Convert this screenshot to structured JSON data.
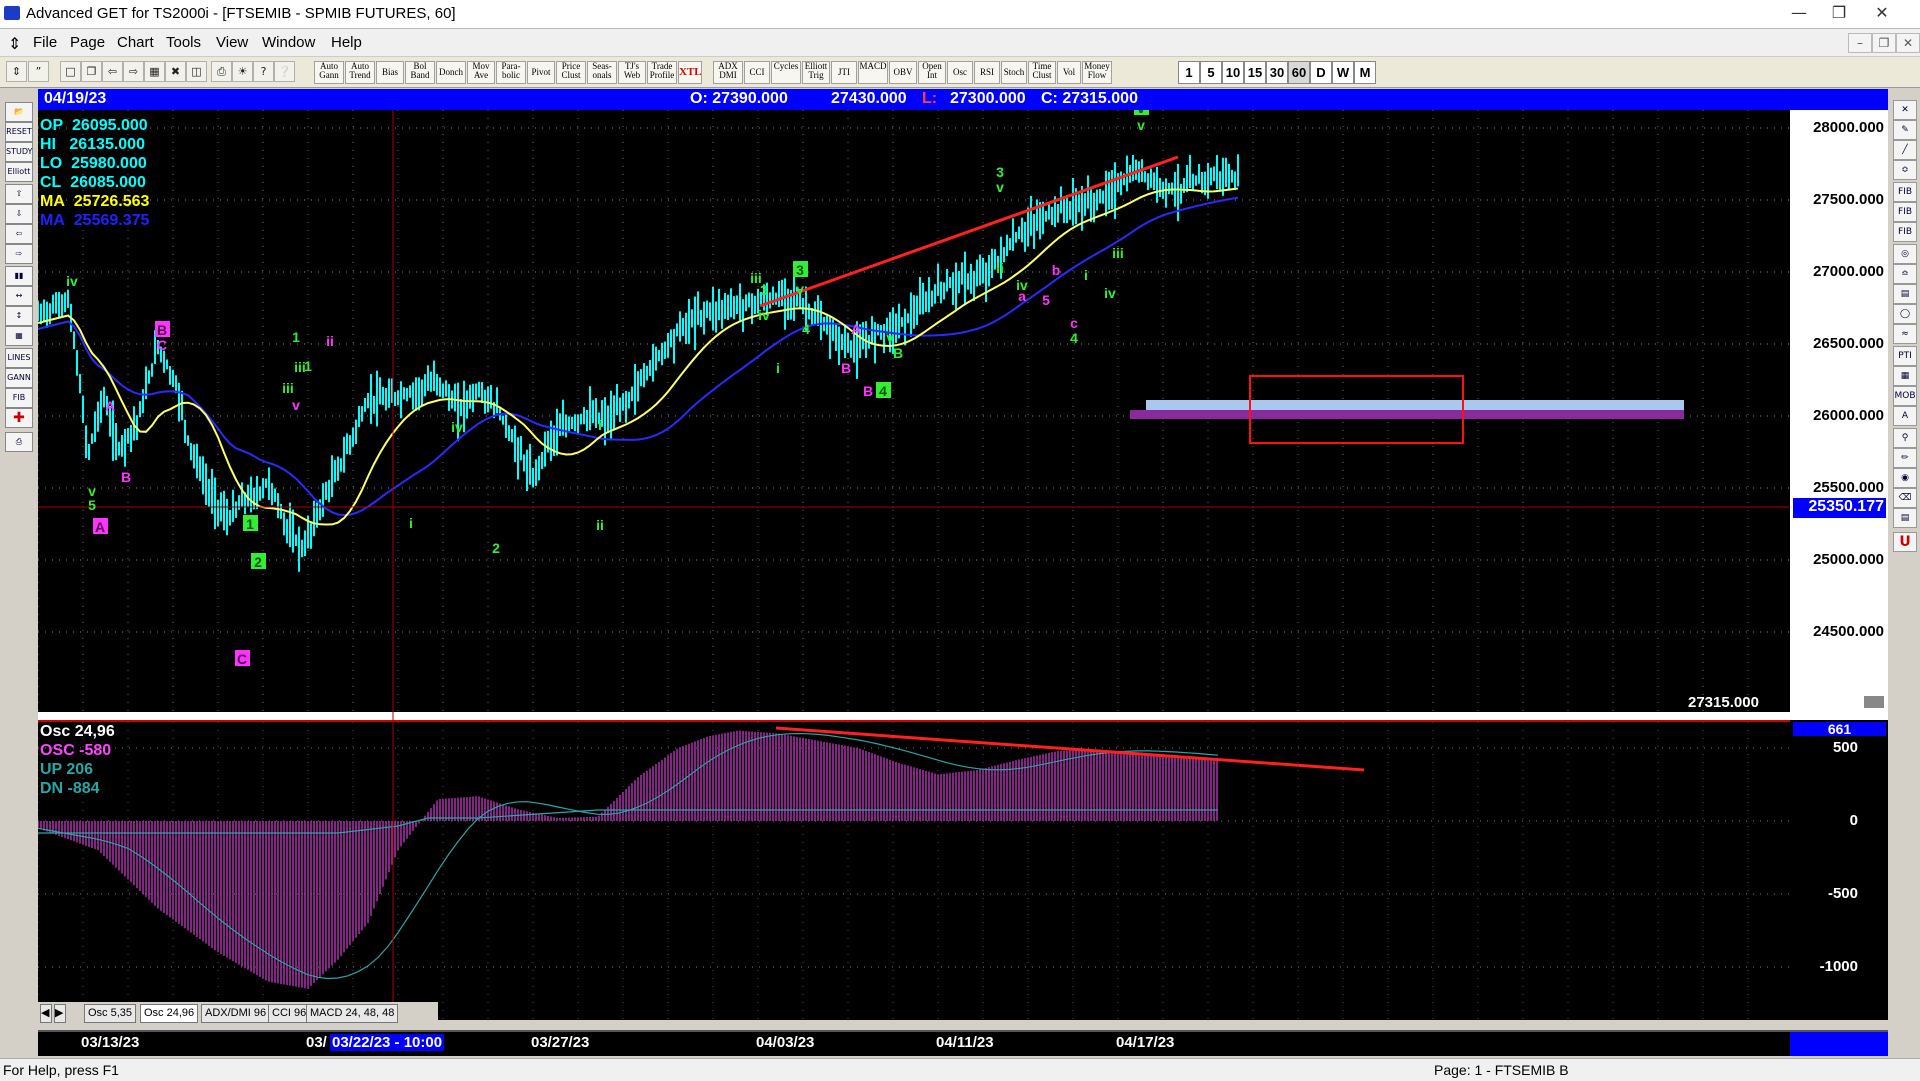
{
  "window": {
    "title": "Advanced GET for TS2000i - [FTSEMIB - SPMIB FUTURES, 60]"
  },
  "menu": [
    "File",
    "Page",
    "Chart",
    "Tools",
    "View",
    "Window",
    "Help"
  ],
  "toolbar": {
    "studies": [
      "Auto Gann",
      "Auto Trend",
      "Bias",
      "Bol Band",
      "Donch",
      "Mov Ave",
      "Para-bolic",
      "Pivot",
      "Price Clust",
      "Seas-onals",
      "TJ's Web",
      "Trade Profile",
      "XTL",
      "ADX DMI",
      "CCI",
      "Cycles",
      "Elliott Trig",
      "JTI",
      "MACD",
      "OBV",
      "Open Int",
      "Osc",
      "RSI",
      "Stoch",
      "Time Clust",
      "Vol",
      "Money Flow"
    ],
    "timeframes": [
      "1",
      "5",
      "10",
      "15",
      "30",
      "60",
      "D",
      "W",
      "M"
    ],
    "selected_timeframe": "60"
  },
  "left_tools": [
    "RESET",
    "STUDY",
    "Elliott",
    "LINES",
    "GANN",
    "FIB"
  ],
  "right_tools": [
    "FIB RET",
    "FIB EXT",
    "FIB TIME",
    "PTI",
    "MOB",
    "A",
    "U"
  ],
  "header": {
    "date": "04/19/23",
    "open": "O: 27390.000",
    "high": "27430.000",
    "low_label": "L:",
    "low": "27300.000",
    "close": "C: 27315.000"
  },
  "price_panel": {
    "legend": [
      {
        "label": "OP",
        "value": "26095.000",
        "color": "#00ffff"
      },
      {
        "label": "HI",
        "value": "26135.000",
        "color": "#00ffff"
      },
      {
        "label": "LO",
        "value": "25980.000",
        "color": "#00ffff"
      },
      {
        "label": "CL",
        "value": "26085.000",
        "color": "#00ffff"
      },
      {
        "label": "MA",
        "value": "25726.563",
        "color": "#ffff00"
      },
      {
        "label": "MA",
        "value": "25569.375",
        "color": "#2020ff"
      }
    ],
    "y_ticks": [
      "28000.000",
      "27500.000",
      "27000.000",
      "26500.000",
      "26000.000",
      "25500.000",
      "25000.000",
      "24500.000"
    ],
    "crosshair_price": "25350.177",
    "last_price": "27315.000",
    "wave_labels": [
      "iv",
      "v",
      "5",
      "A",
      "B",
      "C",
      "1",
      "2",
      "ii",
      "iii",
      "b",
      "a",
      "i",
      "3",
      "4",
      "c"
    ]
  },
  "osc_panel": {
    "legend": [
      {
        "label": "Osc 24,96",
        "color": "#ffffff"
      },
      {
        "label": "OSC -580",
        "color": "#ff44ff"
      },
      {
        "label": "UP   206",
        "color": "#2aa6a6"
      },
      {
        "label": "DN   -884",
        "color": "#2aa6a6"
      }
    ],
    "y_ticks": [
      "500",
      "0",
      "-500",
      "-1000"
    ],
    "current_value": "661"
  },
  "tabs": [
    "Osc 5,35",
    "Osc 24,96",
    "ADX/DMI 96",
    "CCI 96",
    "MACD 24, 48, 48"
  ],
  "active_tab": "Osc 24,96",
  "dates": [
    "03/13/23",
    "03/",
    "03/22/23 - 10:00",
    "03/27/23",
    "04/03/23",
    "04/11/23",
    "04/17/23"
  ],
  "status": {
    "left": "For Help, press F1",
    "right": "Page: 1 - FTSEMIB B"
  },
  "colors": {
    "price_bars": "#00ffff",
    "ma_fast": "#ffff66",
    "ma_slow": "#2a2aff",
    "trendline": "#ff2020",
    "osc_bars": "#b030b0",
    "wave_green": "#33ee33",
    "wave_magenta": "#ff33ff"
  }
}
